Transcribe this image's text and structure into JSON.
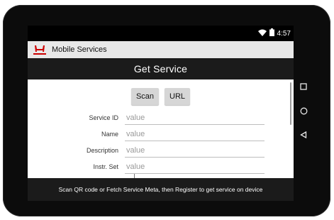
{
  "statusbar": {
    "time": "4:57"
  },
  "app": {
    "title": "Mobile Services",
    "logo_text": "HONDA"
  },
  "header": {
    "title": "Get Service"
  },
  "actions": {
    "scan_label": "Scan",
    "url_label": "URL"
  },
  "form": {
    "fields": [
      {
        "label": "Service ID",
        "placeholder": "value"
      },
      {
        "label": "Name",
        "placeholder": "value"
      },
      {
        "label": "Description",
        "placeholder": "value"
      },
      {
        "label": "Instr. Set",
        "placeholder": "value"
      }
    ]
  },
  "footer": {
    "message": "Scan QR code or Fetch Service Meta, then Register to get service on device"
  },
  "navigation": {
    "icons": [
      "recents-square-icon",
      "home-circle-icon",
      "back-triangle-icon"
    ]
  },
  "colors": {
    "bar_dark": "#1b1b1b",
    "action_bar": "#e8e8e8",
    "honda_red": "#cc0000",
    "button_gray": "#d6d6d6"
  }
}
